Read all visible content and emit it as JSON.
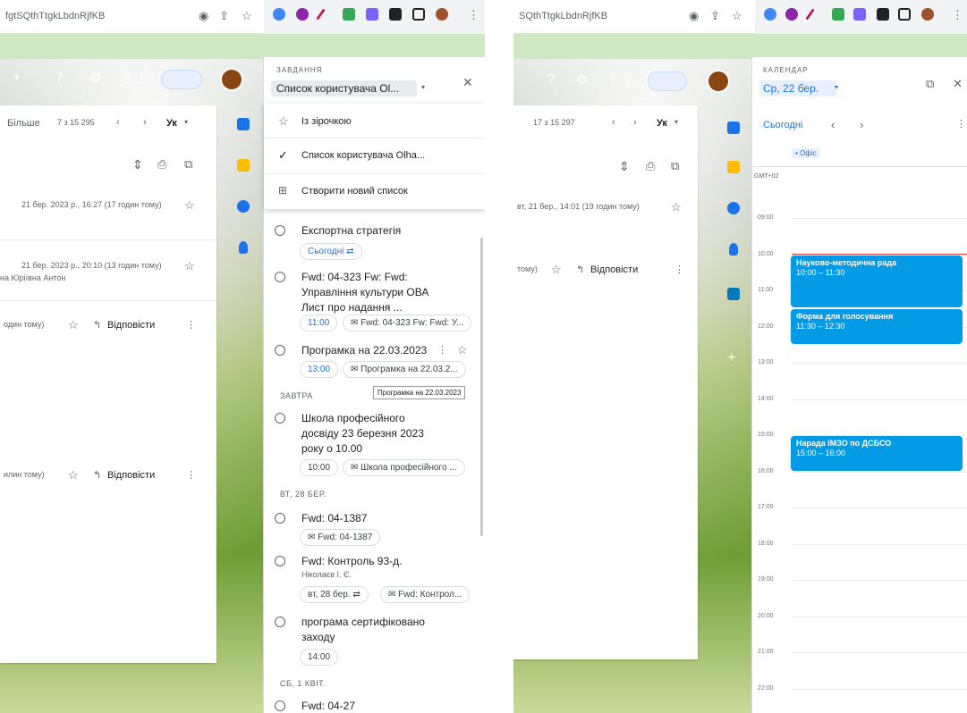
{
  "left": {
    "url": "fgtSQthTtgkLbdnRjfKB",
    "pagination": "7 з 15 295",
    "more_label": "Більше",
    "lang": "Ук",
    "emails": [
      {
        "date": "21 бер. 2023 р., 16:27 (17 годин тому)"
      },
      {
        "date": "21 бер. 2023 р., 20:10 (13 годин тому)",
        "sender": "на Юріївна Антон"
      },
      {
        "date": "один тому)",
        "reply": "Відповісти"
      },
      {
        "date": "илин тому)",
        "reply": "Відповісти"
      }
    ]
  },
  "tasks": {
    "section": "ЗАВДАННЯ",
    "list_select": "Список користувача Ol...",
    "menu": [
      {
        "label": "Із зірочкою"
      },
      {
        "label": "Список користувача Olha..."
      },
      {
        "label": "Створити новий список"
      }
    ],
    "items": [
      {
        "title": "Експортна стратегія",
        "chips": [
          "Сьогодні"
        ]
      },
      {
        "title": "Fwd: 04-323 Fw: Fwd: Управління культури ОВА Лист про надання ...",
        "chips": [
          "11:00",
          "Fwd: 04-323 Fw: Fwd: У..."
        ]
      },
      {
        "title": "Програмка на 22.03.2023",
        "chips": [
          "13:00",
          "Програмка на 22.03.2..."
        ]
      },
      {
        "title": "Школа професійного досвіду 23 березня 2023 року о 10.00",
        "chips": [
          "10:00",
          "Школа професійного ..."
        ]
      },
      {
        "title": "Fwd: 04-1387",
        "chips": [
          "Fwd: 04-1387"
        ]
      },
      {
        "title": "Fwd: Контроль 93-д.",
        "subtitle": "Ніколаєв І. Є.",
        "chips": [
          "вт, 28 бер.",
          "Fwd: Контрол..."
        ]
      },
      {
        "title": "програма сертифіковано заходу",
        "chips": [
          "14:00"
        ]
      },
      {
        "title": "Fwd: 04-27"
      }
    ],
    "sections": [
      "ЗАВТРА",
      "ВТ, 28 БЕР.",
      "СБ, 1 КВІТ."
    ],
    "tooltip": "Програмка на 22.03.2023"
  },
  "right": {
    "url": "SQthTtgkLbdnRjfKB",
    "pagination": "17 з 15 297",
    "lang": "Ук",
    "email_date": "вт, 21 бер., 14:01 (19 годин тому)",
    "email2_date": "тому)",
    "reply": "Відповісти"
  },
  "calendar": {
    "section": "КАЛЕНДАР",
    "date": "Ср, 22 бер.",
    "today": "Сьогодні",
    "allday": "Офіс",
    "tz": "GMT+02",
    "hours": [
      "09:00",
      "10:00",
      "11:00",
      "12:00",
      "13:00",
      "14:00",
      "15:00",
      "16:00",
      "17:00",
      "18:00",
      "19:00",
      "20:00",
      "21:00",
      "22:00"
    ],
    "events": [
      {
        "title": "Науково-методична рада",
        "time": "10:00 – 11:30"
      },
      {
        "title": "Форма для голосування",
        "time": "11:30 – 12:30"
      },
      {
        "title": "Нарада ІМЗО по ДСБСО",
        "time": "15:00 – 16:00"
      }
    ]
  },
  "colors": {
    "accent": "#1a73e8",
    "event": "#039be5",
    "now": "#ea4335"
  }
}
